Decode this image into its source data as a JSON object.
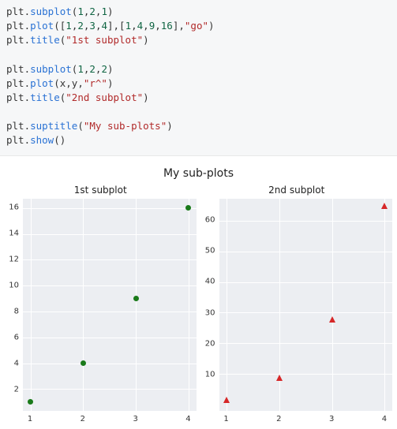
{
  "code": {
    "l1a": "plt.",
    "l1b": "subplot",
    "l1c": "(",
    "l1n1": "1",
    "l1n2": "2",
    "l1n3": "1",
    "l1d": ",",
    "l1e": ")",
    "l2a": "plt.",
    "l2b": "plot",
    "l2c": "([",
    "l2n1": "1",
    "l2n2": "2",
    "l2n3": "3",
    "l2n4": "4",
    "l2d": ",",
    "l2e": "],[",
    "l2n5": "1",
    "l2n6": "4",
    "l2n7": "9",
    "l2n8": "16",
    "l2f": "],",
    "l2s": "\"go\"",
    "l2g": ")",
    "l3a": "plt.",
    "l3b": "title",
    "l3c": "(",
    "l3s": "\"1st subplot\"",
    "l3d": ")",
    "l4a": "plt.",
    "l4b": "subplot",
    "l4c": "(",
    "l4n1": "1",
    "l4n2": "2",
    "l4n3": "2",
    "l4d": ",",
    "l4e": ")",
    "l5a": "plt.",
    "l5b": "plot",
    "l5c": "(x,y,",
    "l5s": "\"r^\"",
    "l5d": ")",
    "l6a": "plt.",
    "l6b": "title",
    "l6c": "(",
    "l6s": "\"2nd subplot\"",
    "l6d": ")",
    "l7a": "plt.",
    "l7b": "suptitle",
    "l7c": "(",
    "l7s": "\"My sub-plots\"",
    "l7d": ")",
    "l8a": "plt.",
    "l8b": "show",
    "l8c": "()"
  },
  "figure": {
    "suptitle": "My sub-plots",
    "sub1": {
      "title": "1st subplot",
      "yticks": [
        "16",
        "14",
        "12",
        "10",
        "8",
        "6",
        "4",
        "2"
      ],
      "xticks": [
        "1",
        "2",
        "3",
        "4"
      ]
    },
    "sub2": {
      "title": "2nd subplot",
      "yticks": [
        "60",
        "50",
        "40",
        "30",
        "20",
        "10"
      ],
      "xticks": [
        "1",
        "2",
        "3",
        "4"
      ]
    }
  },
  "chart_data": [
    {
      "type": "scatter",
      "title": "1st subplot",
      "x": [
        1,
        2,
        3,
        4
      ],
      "y": [
        1,
        4,
        9,
        16
      ],
      "marker": "go",
      "xlim": [
        0.85,
        4.15
      ],
      "ylim": [
        0.3,
        16.7
      ],
      "xticks": [
        1,
        2,
        3,
        4
      ],
      "yticks": [
        2,
        4,
        6,
        8,
        10,
        12,
        14,
        16
      ]
    },
    {
      "type": "scatter",
      "title": "2nd subplot",
      "x": [
        1,
        2,
        3,
        4
      ],
      "y": [
        1,
        8,
        27,
        64
      ],
      "marker": "r^",
      "xlim": [
        0.85,
        4.15
      ],
      "ylim": [
        -2,
        67
      ],
      "xticks": [
        1,
        2,
        3,
        4
      ],
      "yticks": [
        10,
        20,
        30,
        40,
        50,
        60
      ]
    }
  ]
}
